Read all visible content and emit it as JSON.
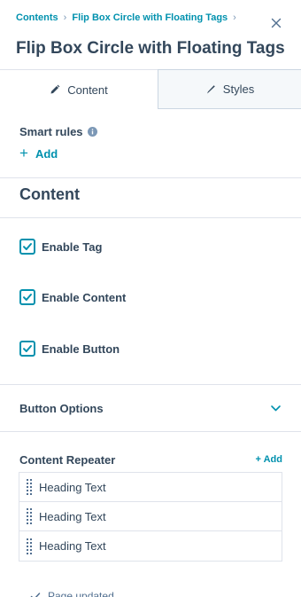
{
  "breadcrumb": {
    "items": [
      "Contents",
      "Flip Box Circle with Floating Tags"
    ],
    "separator": "›"
  },
  "header": {
    "title": "Flip Box Circle with Floating Tags",
    "close_icon": "close-icon"
  },
  "tabs": [
    {
      "label": "Content",
      "icon": "pencil-icon",
      "active": true
    },
    {
      "label": "Styles",
      "icon": "brush-icon",
      "active": false
    }
  ],
  "smart_rules": {
    "label": "Smart rules",
    "add_label": "Add"
  },
  "content_section": {
    "title": "Content",
    "checkboxes": [
      {
        "label": "Enable Tag",
        "checked": true
      },
      {
        "label": "Enable Content",
        "checked": true
      },
      {
        "label": "Enable Button",
        "checked": true
      }
    ]
  },
  "button_options": {
    "label": "Button Options",
    "expanded": false
  },
  "repeater": {
    "title": "Content Repeater",
    "add_label": "+ Add",
    "items": [
      {
        "label": "Heading Text"
      },
      {
        "label": "Heading Text"
      },
      {
        "label": "Heading Text"
      }
    ]
  },
  "toast": {
    "text": "Page updated"
  },
  "colors": {
    "accent": "#0091ae",
    "text": "#33475b",
    "border": "#dfe3eb",
    "tab_inactive_bg": "#f5f8fa"
  }
}
